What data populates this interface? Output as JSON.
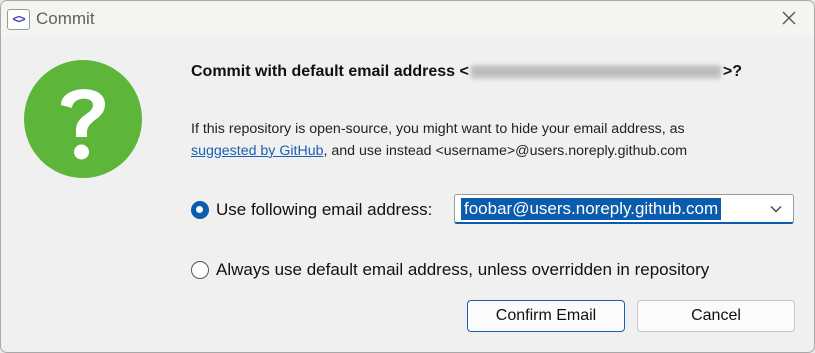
{
  "window": {
    "title": "Commit",
    "app_icon_glyph": "<>"
  },
  "dialog": {
    "icon": "question-icon",
    "icon_color": "#5db53a",
    "heading_prefix": "Commit with default email address <",
    "heading_suffix": ">?",
    "info_line1": "If this repository is open-source, you might want to hide your email address, as",
    "info_link": "suggested by GitHub",
    "info_line2_rest": ", and use instead <username>@users.noreply.github.com",
    "option_custom": {
      "label": "Use following email address:",
      "selected": true,
      "value": "foobar@users.noreply.github.com"
    },
    "option_default": {
      "label": "Always use default email address, unless overridden in repository",
      "selected": false
    },
    "confirm_label": "Confirm Email",
    "cancel_label": "Cancel",
    "accent_color": "#0b5cad"
  }
}
